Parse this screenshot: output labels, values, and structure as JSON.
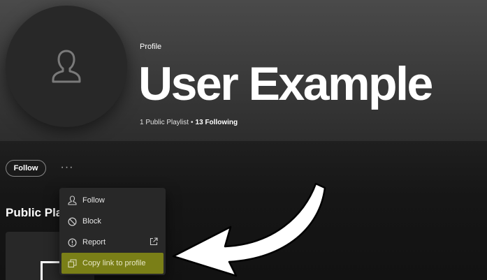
{
  "profile": {
    "type_label": "Profile",
    "name": "User Example",
    "public_playlists": "1 Public Playlist",
    "separator": "•",
    "following": "13 Following"
  },
  "actions": {
    "follow_label": "Follow",
    "more_label": "···"
  },
  "sections": {
    "public_playlists_title": "Public Pla"
  },
  "context_menu": {
    "items": [
      {
        "label": "Follow",
        "icon": "user-icon"
      },
      {
        "label": "Block",
        "icon": "block-icon"
      },
      {
        "label": "Report",
        "icon": "report-icon",
        "trailing_icon": "external-link-icon"
      },
      {
        "label": "Copy link to profile",
        "icon": "copy-icon",
        "highlighted": true
      }
    ]
  },
  "colors": {
    "highlight": "#7a7f17",
    "header_top": "#4a4a4a",
    "background": "#121212",
    "annotation_arrow": "#ffffff"
  }
}
